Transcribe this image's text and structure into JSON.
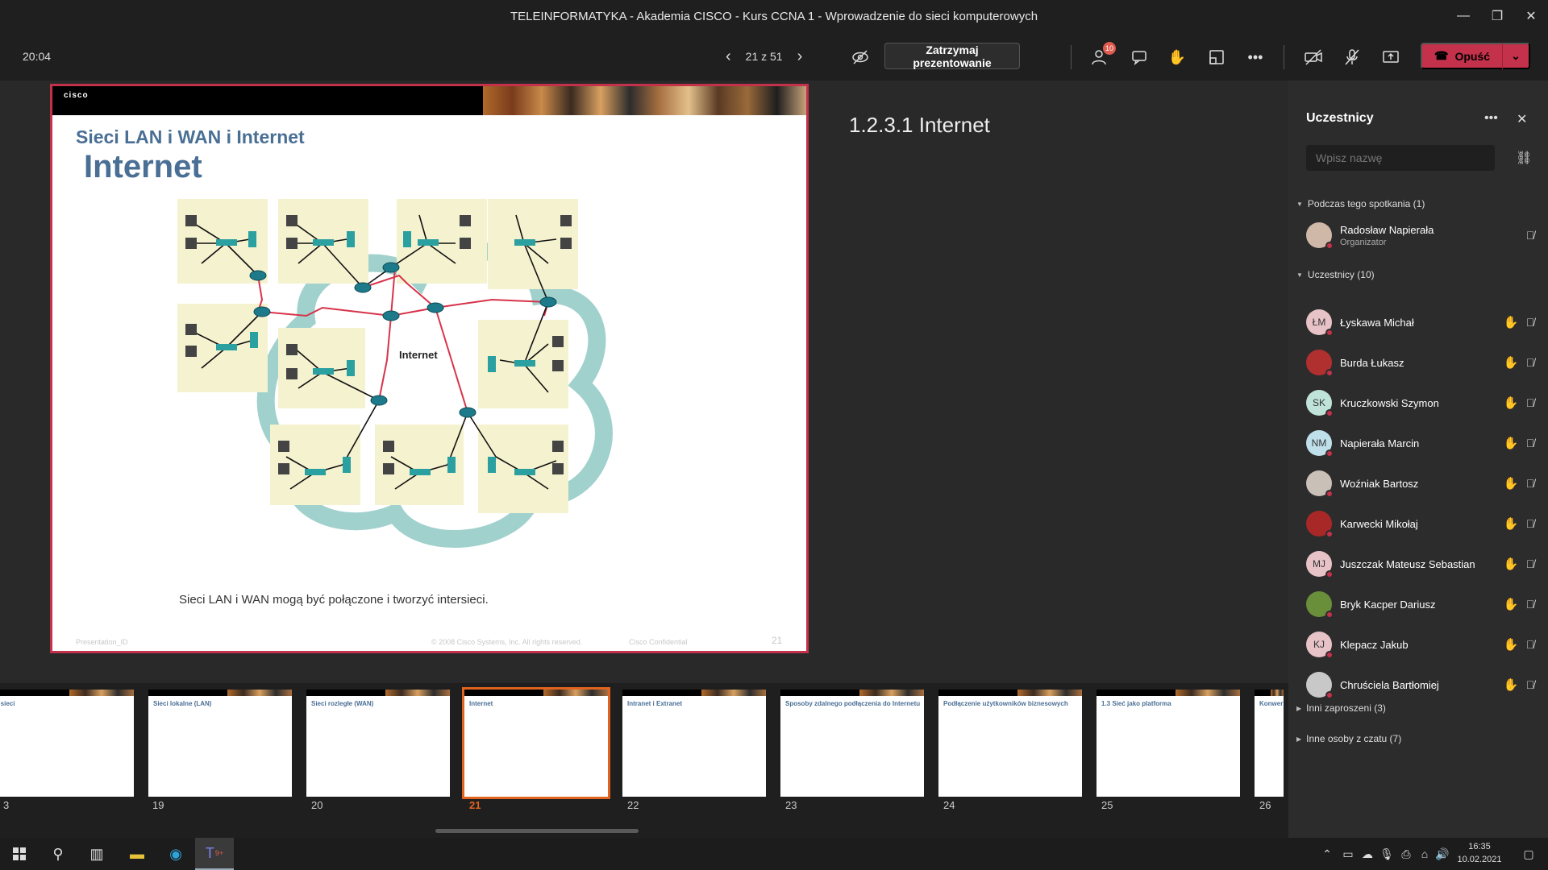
{
  "window": {
    "title": "TELEINFORMATYKA - Akademia CISCO - Kurs CCNA 1 - Wprowadzenie do sieci komputerowych"
  },
  "toolbar": {
    "clock": "20:04",
    "slide_position": "21 z 51",
    "stop_presenting": "Zatrzymaj prezentowanie",
    "participants_badge": "10",
    "leave": "Opuść"
  },
  "slide": {
    "logo": "cisco",
    "subtitle": "Sieci LAN i WAN i Internet",
    "title": "Internet",
    "diagram_label": "Internet",
    "caption": "Sieci LAN i WAN mogą być połączone i tworzyć intersieci.",
    "footer_left": "Presentation_ID",
    "footer_mid": "© 2008 Cisco Systems, Inc. All rights reserved.",
    "footer_right": "Cisco Confidential",
    "number": "21"
  },
  "notes": {
    "title": "1.2.3.1 Internet"
  },
  "thumbnails": [
    {
      "num": "3",
      "title": "y sieci"
    },
    {
      "num": "19",
      "title": "Sieci lokalne (LAN)"
    },
    {
      "num": "20",
      "title": "Sieci rozległe (WAN)"
    },
    {
      "num": "21",
      "title": "Internet"
    },
    {
      "num": "22",
      "title": "Intranet i Extranet"
    },
    {
      "num": "23",
      "title": "Sposoby zdalnego podłączenia do Internetu"
    },
    {
      "num": "24",
      "title": "Podłączenie użytkowników biznesowych"
    },
    {
      "num": "25",
      "title": "1.3 Sieć jako platforma"
    },
    {
      "num": "26",
      "title": "Konwer"
    }
  ],
  "panel": {
    "title": "Uczestnicy",
    "search_placeholder": "Wpisz nazwę",
    "section_meeting": "Podczas tego spotkania (1)",
    "organizer": {
      "name": "Radosław Napierała",
      "role": "Organizator"
    },
    "section_participants": "Uczestnicy (10)",
    "participants": [
      {
        "initials": "ŁM",
        "name": "Łyskawa Michał",
        "color": "#e7c3c7"
      },
      {
        "initials": "",
        "name": "Burda Łukasz",
        "color": "#b03030"
      },
      {
        "initials": "SK",
        "name": "Kruczkowski Szymon",
        "color": "#bfe3d8"
      },
      {
        "initials": "NM",
        "name": "Napierała Marcin",
        "color": "#bfe0ea"
      },
      {
        "initials": "",
        "name": "Woźniak Bartosz",
        "color": "#c9c0b8"
      },
      {
        "initials": "",
        "name": "Karwecki Mikołaj",
        "color": "#a82828"
      },
      {
        "initials": "MJ",
        "name": "Juszczak Mateusz Sebastian",
        "color": "#e7c3c7"
      },
      {
        "initials": "",
        "name": "Bryk Kacper Dariusz",
        "color": "#6a8f3a"
      },
      {
        "initials": "KJ",
        "name": "Klepacz Jakub",
        "color": "#e7c3c7"
      },
      {
        "initials": "",
        "name": "Chruściela Bartłomiej",
        "color": "#c8c8c8"
      }
    ],
    "section_invited": "Inni zaproszeni (3)",
    "section_chat": "Inne osoby z czatu (7)"
  },
  "taskbar": {
    "time": "16:35",
    "date": "10.02.2021",
    "teams_badge": "9+"
  },
  "colors": {
    "accent": "#c4314b",
    "active_thumb": "#e0641f",
    "hand": "#e8b12c",
    "slide_title": "#4a6f95"
  }
}
